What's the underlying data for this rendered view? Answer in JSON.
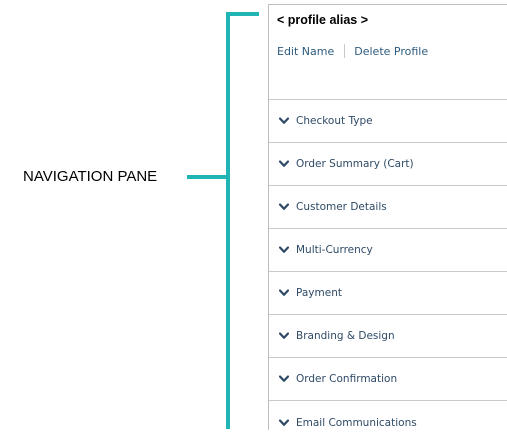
{
  "annotation": {
    "label": "NAVIGATION PANE",
    "color": "#1fb5b5"
  },
  "panel": {
    "profile_alias": "< profile alias >",
    "actions": {
      "edit_label": "Edit Name",
      "delete_label": "Delete Profile"
    },
    "nav_items": [
      {
        "label": "Checkout Type",
        "icon": "chevron-down-icon"
      },
      {
        "label": "Order Summary (Cart)",
        "icon": "chevron-down-icon"
      },
      {
        "label": "Customer Details",
        "icon": "chevron-down-icon"
      },
      {
        "label": "Multi-Currency",
        "icon": "chevron-down-icon"
      },
      {
        "label": "Payment",
        "icon": "chevron-down-icon"
      },
      {
        "label": "Branding & Design",
        "icon": "chevron-down-icon"
      },
      {
        "label": "Order Confirmation",
        "icon": "chevron-down-icon"
      },
      {
        "label": "Email Communications",
        "icon": "chevron-down-icon"
      }
    ]
  }
}
